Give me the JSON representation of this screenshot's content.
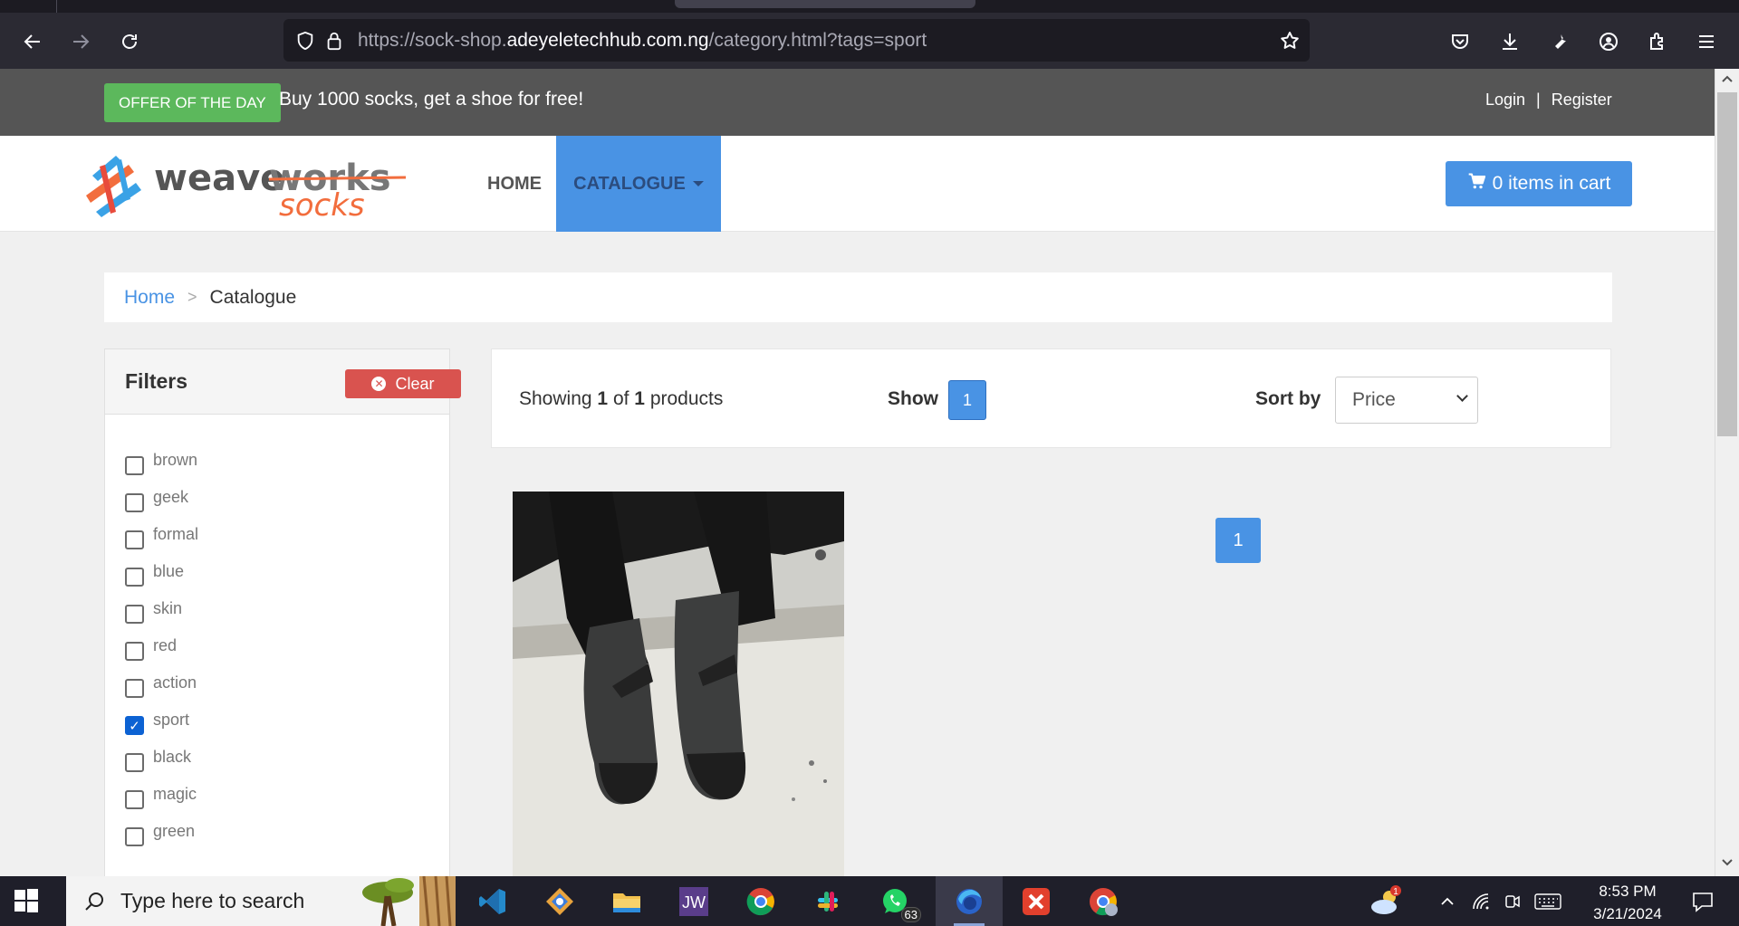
{
  "browser": {
    "url_prefix": "https://sock-shop.",
    "url_domain": "adeyeletechhub.com.ng",
    "url_path": "/category.html?tags=sport"
  },
  "offer": {
    "badge": "OFFER OF THE DAY",
    "text": "Buy 1000 socks, get a shoe for free!"
  },
  "auth": {
    "login": "Login",
    "sep": "|",
    "register": "Register"
  },
  "nav": {
    "home": "HOME",
    "catalogue": "CATALOGUE",
    "cart": "0 items in cart"
  },
  "breadcrumb": {
    "home": "Home",
    "sep": ">",
    "current": "Catalogue"
  },
  "filters": {
    "title": "Filters",
    "clear": "Clear",
    "items": [
      {
        "label": "brown",
        "checked": false
      },
      {
        "label": "geek",
        "checked": false
      },
      {
        "label": "formal",
        "checked": false
      },
      {
        "label": "blue",
        "checked": false
      },
      {
        "label": "skin",
        "checked": false
      },
      {
        "label": "red",
        "checked": false
      },
      {
        "label": "action",
        "checked": false
      },
      {
        "label": "sport",
        "checked": true
      },
      {
        "label": "black",
        "checked": false
      },
      {
        "label": "magic",
        "checked": false
      },
      {
        "label": "green",
        "checked": false
      }
    ]
  },
  "results": {
    "showing_prefix": "Showing",
    "shown": "1",
    "of": "of",
    "total": "1",
    "products": "products",
    "show_label": "Show",
    "show_value": "1",
    "sort_label": "Sort by",
    "sort_value": "Price",
    "page": "1"
  },
  "taskbar": {
    "search_placeholder": "Type here to search",
    "time": "8:53 PM",
    "date": "3/21/2024",
    "whatsapp_badge": "63",
    "weather_badge": "1"
  },
  "colors": {
    "accent": "#4993e4",
    "offer_green": "#5cb85c",
    "clear_red": "#d9534f"
  }
}
